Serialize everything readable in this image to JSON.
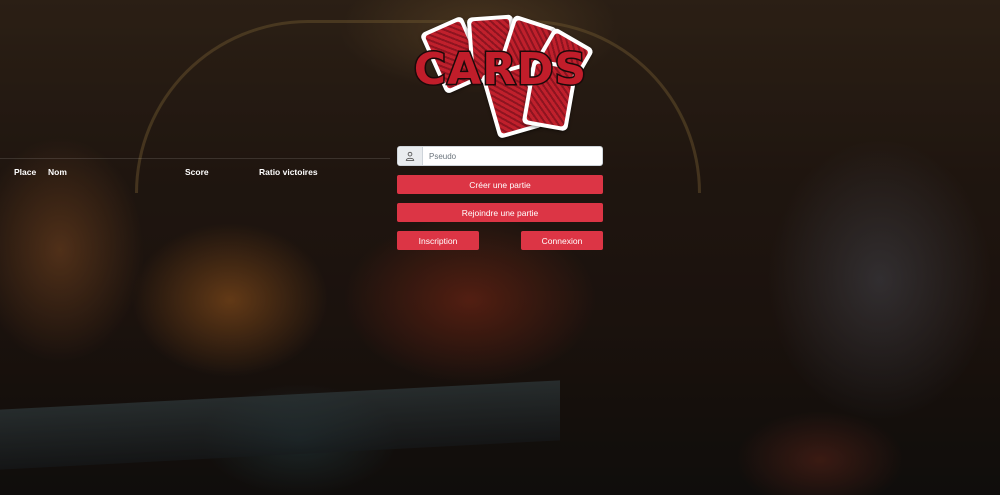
{
  "leaderboard": {
    "columns": {
      "place": "Place",
      "nom": "Nom",
      "score": "Score",
      "ratio": "Ratio victoires"
    }
  },
  "logo": {
    "text": "CARDS"
  },
  "form": {
    "pseudo_placeholder": "Pseudo",
    "pseudo_value": "",
    "user_icon": "user-icon",
    "create_game_label": "Créer une partie",
    "join_game_label": "Rejoindre une partie",
    "signup_label": "Inscription",
    "login_label": "Connexion"
  },
  "colors": {
    "accent": "#dc3545",
    "logo_red": "#c11d2a"
  }
}
